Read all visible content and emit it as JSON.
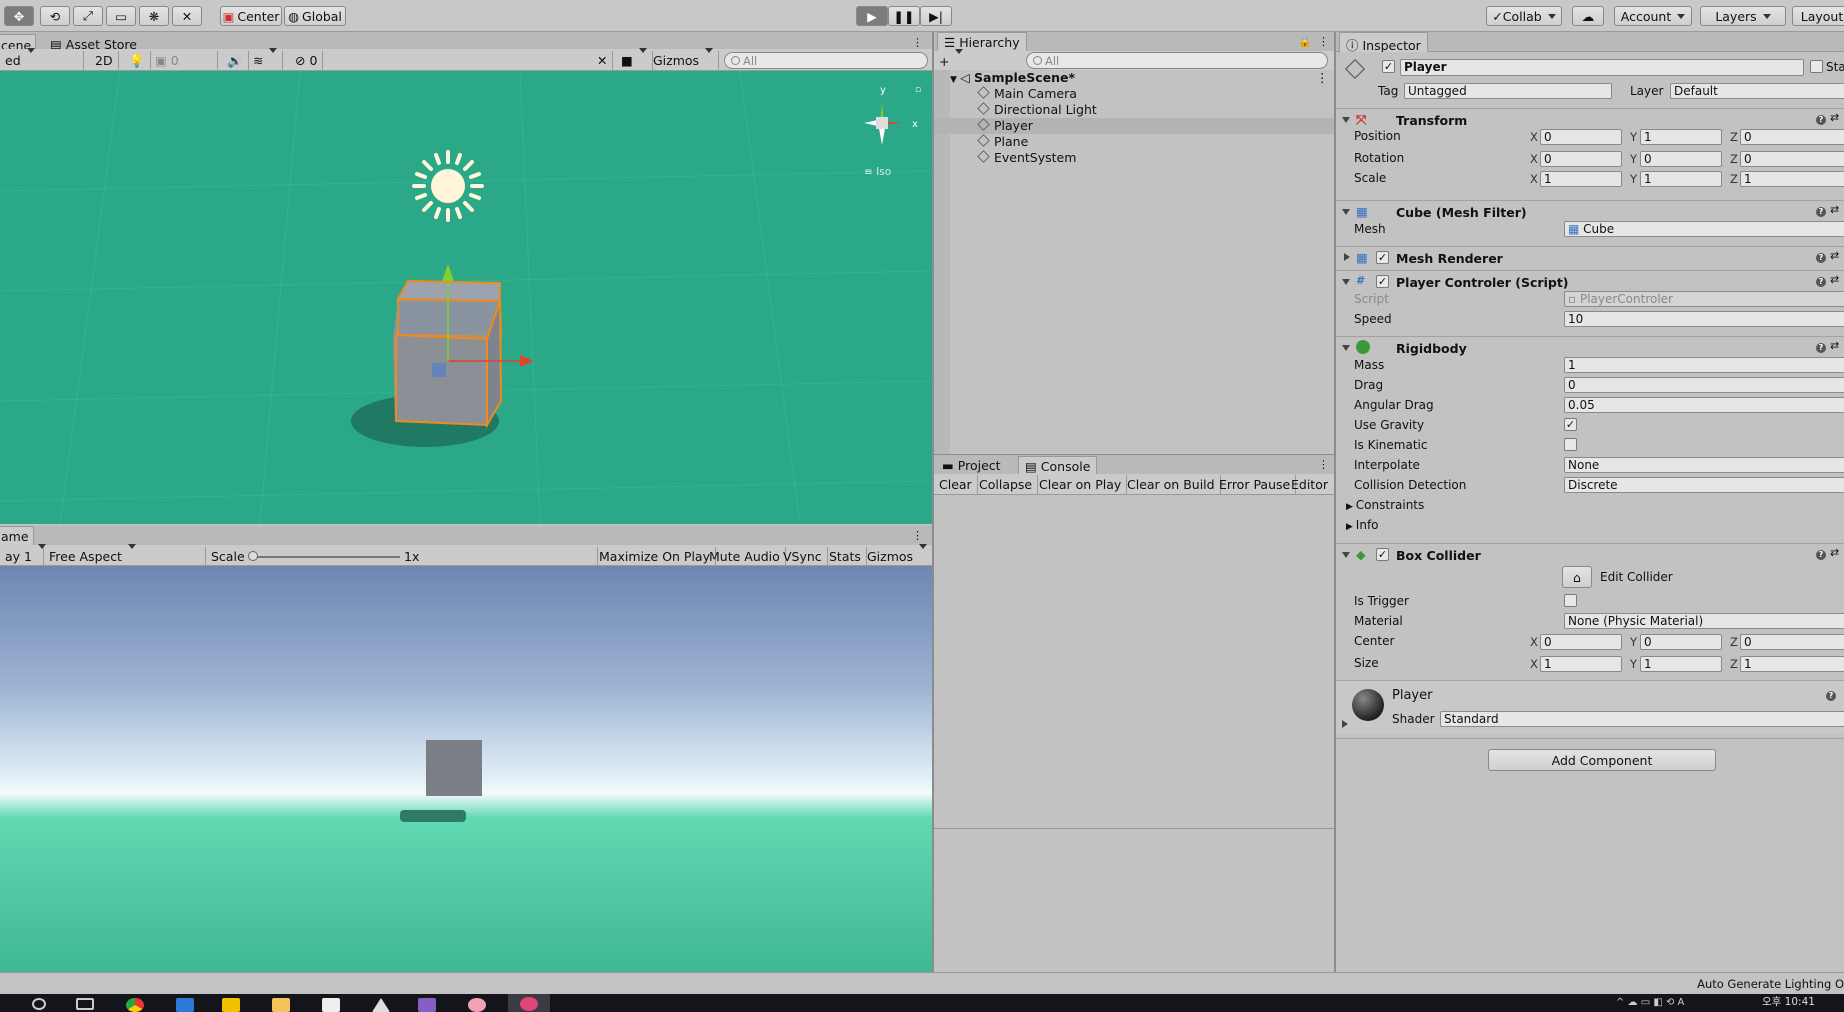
{
  "toolbar": {
    "pivot_center": "Center",
    "pivot_global": "Global",
    "collab": "Collab",
    "account": "Account",
    "layers": "Layers",
    "layout": "Layout"
  },
  "scene_panel": {
    "tab_scene": "cene",
    "tab_asset_store": "Asset Store",
    "draw_mode": "ed",
    "btn_2d": "2D",
    "audio_count": "0",
    "fx_count": "0",
    "gizmos": "Gizmos",
    "search_placeholder": "All",
    "gizmo_axis_y": "y",
    "gizmo_axis_x": "x",
    "projection": "Iso"
  },
  "game_panel": {
    "tab_game": "ame",
    "display": "ay 1",
    "aspect": "Free Aspect",
    "scale_label": "Scale",
    "scale_value": "1x",
    "maximize_on_play": "Maximize On Play",
    "mute_audio": "Mute Audio",
    "vsync": "VSync",
    "stats": "Stats",
    "gizmos": "Gizmos"
  },
  "hierarchy": {
    "tab": "Hierarchy",
    "search_placeholder": "All",
    "scene_name": "SampleScene*",
    "items": [
      "Main Camera",
      "Directional Light",
      "Player",
      "Plane",
      "EventSystem"
    ],
    "selected_index": 2
  },
  "console": {
    "tab_project": "Project",
    "tab_console": "Console",
    "buttons": [
      "Clear",
      "Collapse",
      "Clear on Play",
      "Clear on Build",
      "Error Pause",
      "Editor"
    ]
  },
  "inspector": {
    "tab": "Inspector",
    "object_name": "Player",
    "static_label": "Stat",
    "tag_label": "Tag",
    "tag_value": "Untagged",
    "layer_label": "Layer",
    "layer_value": "Default",
    "transform": {
      "title": "Transform",
      "position_label": "Position",
      "position": [
        "0",
        "1",
        "0"
      ],
      "rotation_label": "Rotation",
      "rotation": [
        "0",
        "0",
        "0"
      ],
      "scale_label": "Scale",
      "scale": [
        "1",
        "1",
        "1"
      ]
    },
    "mesh_filter": {
      "title": "Cube (Mesh Filter)",
      "mesh_label": "Mesh",
      "mesh_value": "Cube"
    },
    "mesh_renderer": {
      "title": "Mesh Renderer"
    },
    "script": {
      "title": "Player Controler (Script)",
      "script_label": "Script",
      "script_value": "PlayerControler",
      "speed_label": "Speed",
      "speed_value": "10"
    },
    "rigidbody": {
      "title": "Rigidbody",
      "mass_label": "Mass",
      "mass": "1",
      "drag_label": "Drag",
      "drag": "0",
      "angular_drag_label": "Angular Drag",
      "angular_drag": "0.05",
      "use_gravity_label": "Use Gravity",
      "use_gravity": true,
      "is_kinematic_label": "Is Kinematic",
      "is_kinematic": false,
      "interpolate_label": "Interpolate",
      "interpolate": "None",
      "collision_label": "Collision Detection",
      "collision": "Discrete",
      "constraints_label": "Constraints",
      "info_label": "Info"
    },
    "box_collider": {
      "title": "Box Collider",
      "edit_collider": "Edit Collider",
      "is_trigger_label": "Is Trigger",
      "is_trigger": false,
      "material_label": "Material",
      "material": "None (Physic Material)",
      "center_label": "Center",
      "center": [
        "0",
        "0",
        "0"
      ],
      "size_label": "Size",
      "size": [
        "1",
        "1",
        "1"
      ]
    },
    "material": {
      "name": "Player",
      "shader_label": "Shader",
      "shader": "Standard"
    },
    "add_component": "Add Component",
    "axis_x": "X",
    "axis_y": "Y",
    "axis_z": "Z"
  },
  "status": {
    "right_text": "Auto Generate Lighting O"
  },
  "taskbar": {
    "clock_ampm": "오후",
    "clock_time": "10:41"
  },
  "colors": {
    "scene_bg": "#2aa888",
    "selection_outline": "#f08a1c",
    "panel_bg": "#c2c2c2"
  }
}
